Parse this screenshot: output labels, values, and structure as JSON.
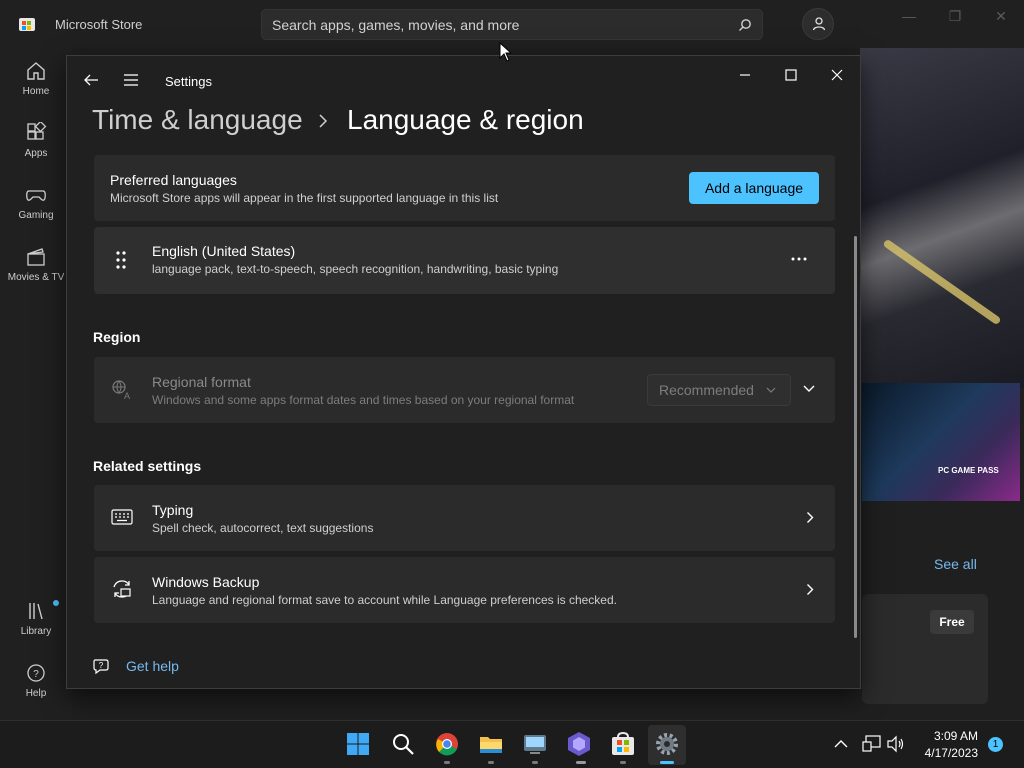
{
  "store": {
    "title": "Microsoft Store",
    "search_placeholder": "Search apps, games, movies, and more",
    "nav": [
      {
        "label": "Home",
        "icon": "home-icon"
      },
      {
        "label": "Apps",
        "icon": "apps-icon"
      },
      {
        "label": "Gaming",
        "icon": "gamepad-icon"
      },
      {
        "label": "Movies & TV",
        "icon": "movies-icon"
      },
      {
        "label": "Library",
        "icon": "library-icon"
      },
      {
        "label": "Help",
        "icon": "help-icon"
      }
    ],
    "see_all": "See all",
    "free_badge": "Free",
    "gamepass_label": "PC GAME PASS",
    "accent_color": "#4cc2ff"
  },
  "settings": {
    "window_title": "Settings",
    "breadcrumb_parent": "Time & language",
    "breadcrumb_current": "Language & region",
    "preferred": {
      "title": "Preferred languages",
      "subtitle": "Microsoft Store apps will appear in the first supported language in this list",
      "add_button": "Add a language"
    },
    "language": {
      "name": "English (United States)",
      "features": "language pack, text-to-speech, speech recognition, handwriting, basic typing"
    },
    "region_header": "Region",
    "regional_format": {
      "title": "Regional format",
      "subtitle": "Windows and some apps format dates and times based on your regional format",
      "value": "Recommended"
    },
    "related_header": "Related settings",
    "typing": {
      "title": "Typing",
      "subtitle": "Spell check, autocorrect, text suggestions"
    },
    "backup": {
      "title": "Windows Backup",
      "subtitle": "Language and regional format save to account while Language preferences is checked."
    },
    "get_help": "Get help"
  },
  "taskbar": {
    "time": "3:09 AM",
    "date": "4/17/2023",
    "notification_count": "1"
  }
}
